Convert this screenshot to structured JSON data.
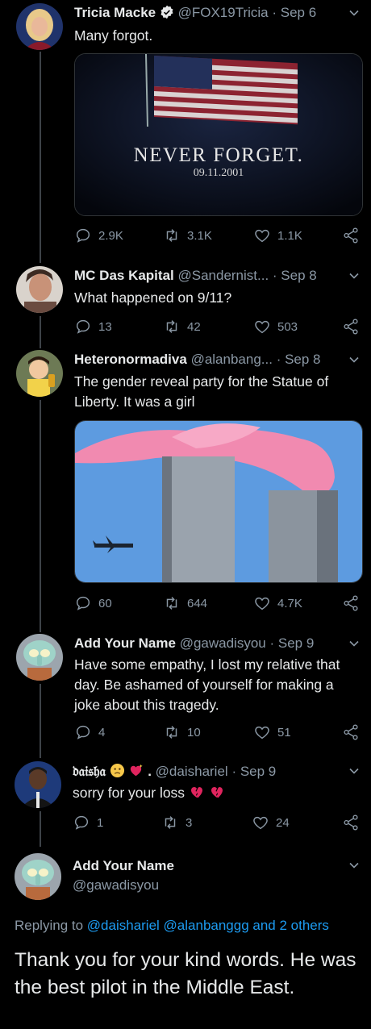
{
  "tweets": [
    {
      "name": "Tricia Macke",
      "handle": "@FOX19Tricia",
      "date": "· Sep 6",
      "text": "Many forgot.",
      "image": {
        "title": "NEVER FORGET.",
        "date": "09.11.2001"
      },
      "stats": {
        "replies": "2.9K",
        "retweets": "3.1K",
        "likes": "1.1K"
      }
    },
    {
      "name": "MC Das Kapital",
      "handle": "@Sandernist...",
      "date": "· Sep 8",
      "text": "What happened on 9/11?",
      "stats": {
        "replies": "13",
        "retweets": "42",
        "likes": "503"
      }
    },
    {
      "name": "Heteronormadiva",
      "handle": "@alanbang...",
      "date": "· Sep 8",
      "text": "The gender reveal party for the Statue of Liberty. It was a girl",
      "stats": {
        "replies": "60",
        "retweets": "644",
        "likes": "4.7K"
      }
    },
    {
      "name": "Add Your Name",
      "handle": "@gawadisyou",
      "date": "· Sep 9",
      "text": "Have some empathy, I lost my relative that day.  Be ashamed of yourself for making a joke about this tragedy.",
      "stats": {
        "replies": "4",
        "retweets": "10",
        "likes": "51"
      }
    },
    {
      "name": "𝔡𝔞𝔦𝔰𝔥𝔞",
      "name_suffix": ".",
      "handle": "@daishariel",
      "date": "· Sep 9",
      "text": "sorry for your loss",
      "stats": {
        "replies": "1",
        "retweets": "3",
        "likes": "24"
      }
    }
  ],
  "focused": {
    "name": "Add Your Name",
    "handle": "@gawadisyou",
    "replying_prefix": "Replying to",
    "replying_to": "@daishariel @alanbanggg and 2 others",
    "text": "Thank you for your kind words. He was the best pilot in the Middle East."
  },
  "colors": {
    "background": "#000000",
    "text": "#e7e9ea",
    "muted": "#8b98a5",
    "link": "#1d9bf0",
    "thread_line": "#3d4248",
    "broken_heart": "#e0245e"
  }
}
